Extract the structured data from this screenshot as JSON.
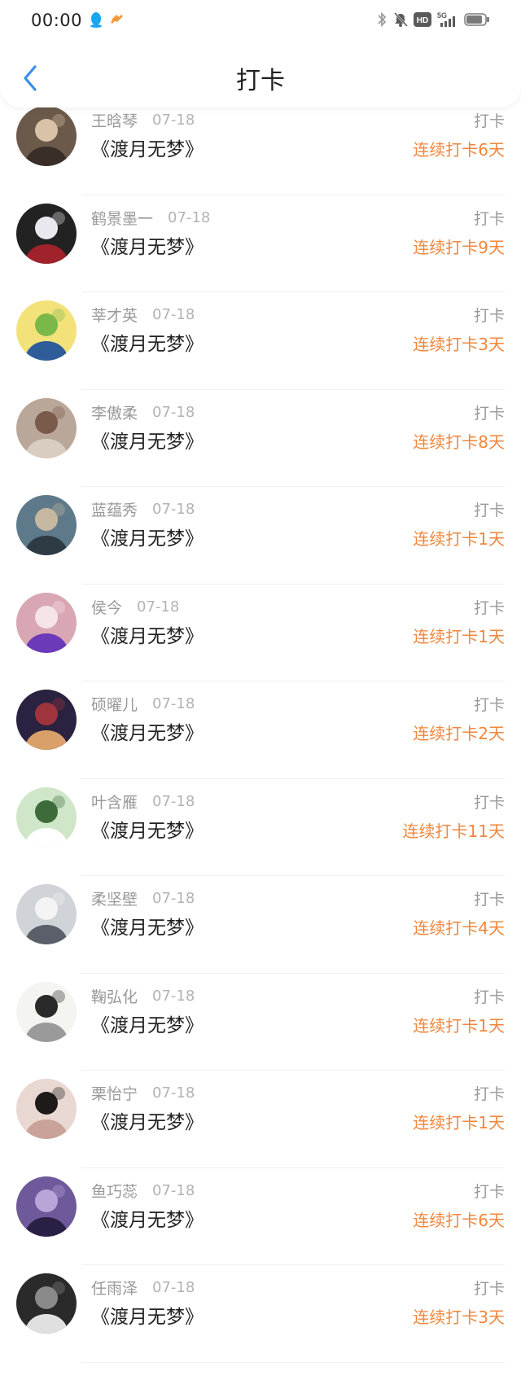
{
  "status_bar": {
    "time": "00:00",
    "network": "5G",
    "hd": "HD"
  },
  "header": {
    "title": "打卡",
    "back_icon": "chevron-left-icon"
  },
  "colors": {
    "accent": "#3a8ee6",
    "streak": "#f2863b",
    "muted": "#999999"
  },
  "entries": [
    {
      "name": "王晗琴",
      "date": "07-18",
      "book": "《渡月无梦》",
      "label": "打卡",
      "streak": "连续打卡6天"
    },
    {
      "name": "鹤景墨一",
      "date": "07-18",
      "book": "《渡月无梦》",
      "label": "打卡",
      "streak": "连续打卡9天"
    },
    {
      "name": "莘才英",
      "date": "07-18",
      "book": "《渡月无梦》",
      "label": "打卡",
      "streak": "连续打卡3天"
    },
    {
      "name": "李傲柔",
      "date": "07-18",
      "book": "《渡月无梦》",
      "label": "打卡",
      "streak": "连续打卡8天"
    },
    {
      "name": "蓝蕴秀",
      "date": "07-18",
      "book": "《渡月无梦》",
      "label": "打卡",
      "streak": "连续打卡1天"
    },
    {
      "name": "侯今",
      "date": "07-18",
      "book": "《渡月无梦》",
      "label": "打卡",
      "streak": "连续打卡1天"
    },
    {
      "name": "硕曜儿",
      "date": "07-18",
      "book": "《渡月无梦》",
      "label": "打卡",
      "streak": "连续打卡2天"
    },
    {
      "name": "叶含雁",
      "date": "07-18",
      "book": "《渡月无梦》",
      "label": "打卡",
      "streak": "连续打卡11天"
    },
    {
      "name": "柔坚壁",
      "date": "07-18",
      "book": "《渡月无梦》",
      "label": "打卡",
      "streak": "连续打卡4天"
    },
    {
      "name": "鞠弘化",
      "date": "07-18",
      "book": "《渡月无梦》",
      "label": "打卡",
      "streak": "连续打卡1天"
    },
    {
      "name": "栗怡宁",
      "date": "07-18",
      "book": "《渡月无梦》",
      "label": "打卡",
      "streak": "连续打卡1天"
    },
    {
      "name": "鱼巧蕊",
      "date": "07-18",
      "book": "《渡月无梦》",
      "label": "打卡",
      "streak": "连续打卡6天"
    },
    {
      "name": "任雨泽",
      "date": "07-18",
      "book": "《渡月无梦》",
      "label": "打卡",
      "streak": "连续打卡3天"
    }
  ]
}
